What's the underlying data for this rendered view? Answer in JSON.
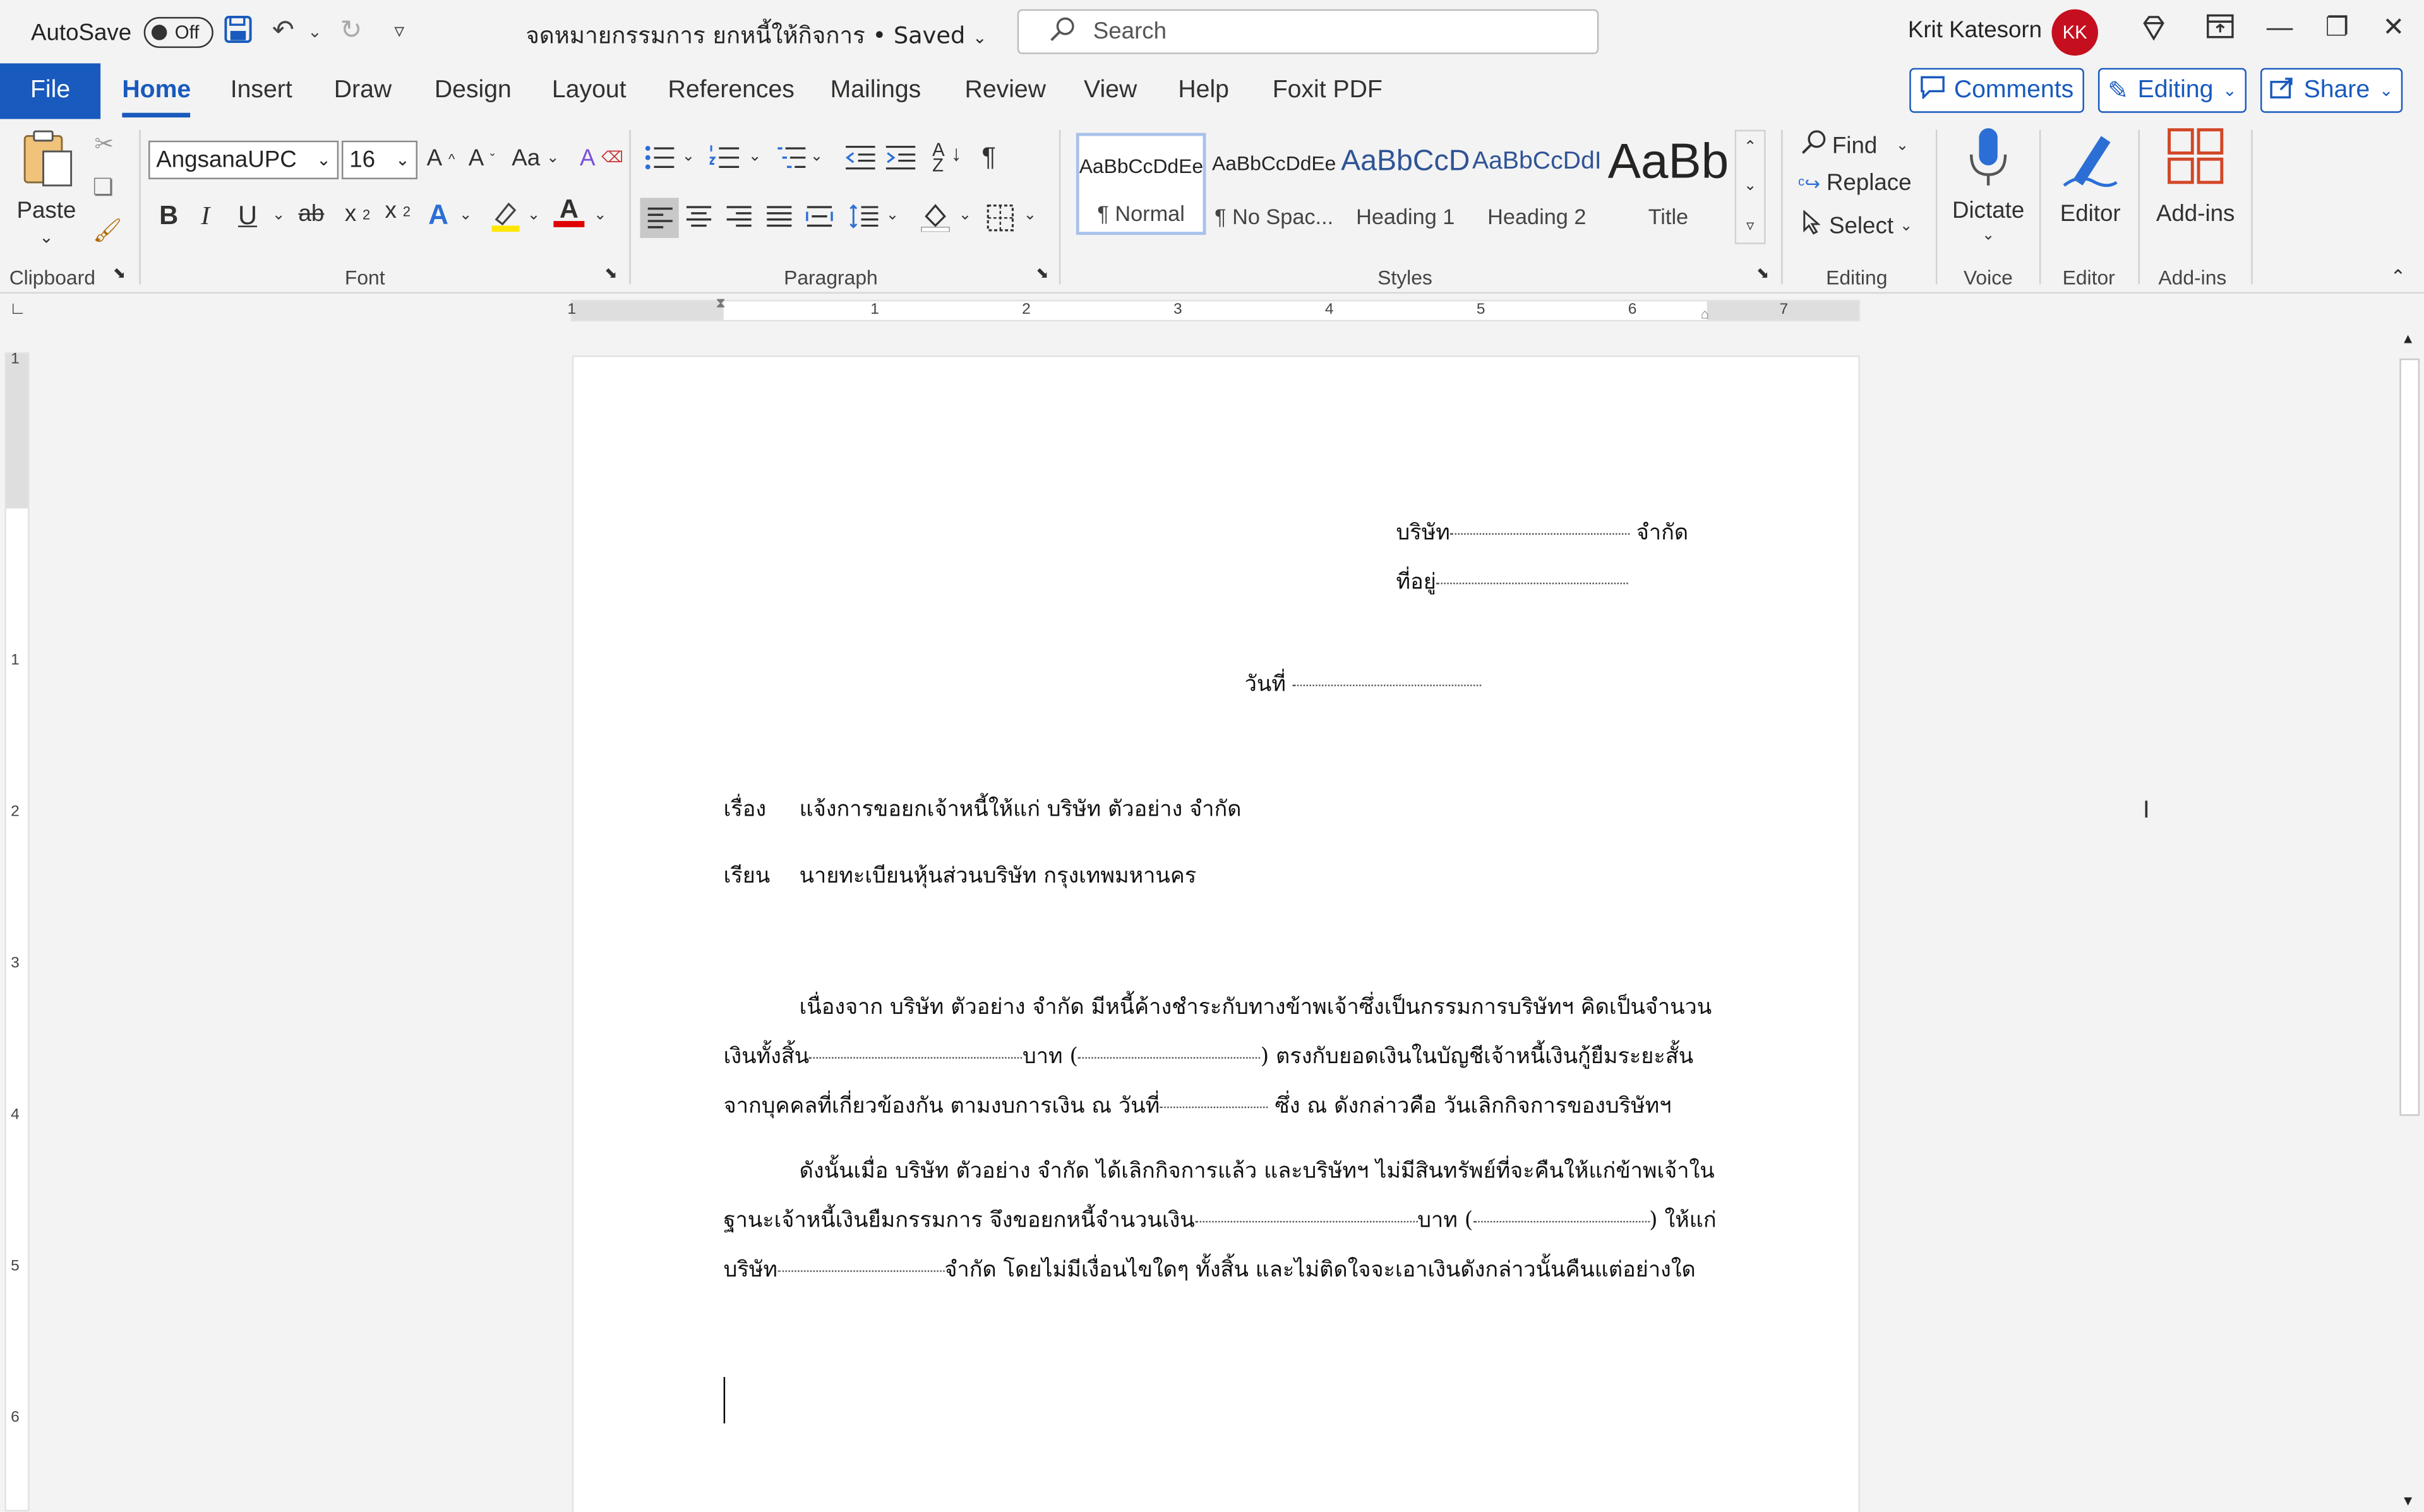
{
  "titlebar": {
    "autosave_label": "AutoSave",
    "autosave_state": "Off",
    "doc_title": "จดหมายกรรมการ ยกหนี้ให้กิจการ • Saved",
    "search_placeholder": "Search",
    "user_name": "Krit Katesorn",
    "user_initials": "KK"
  },
  "tabs": {
    "file": "File",
    "home": "Home",
    "insert": "Insert",
    "draw": "Draw",
    "design": "Design",
    "layout": "Layout",
    "references": "References",
    "mailings": "Mailings",
    "review": "Review",
    "view": "View",
    "help": "Help",
    "foxit": "Foxit PDF",
    "comments": "Comments",
    "editing": "Editing",
    "share": "Share"
  },
  "ribbon": {
    "clipboard": {
      "paste": "Paste",
      "label": "Clipboard"
    },
    "font": {
      "family": "AngsanaUPC",
      "size": "16",
      "label": "Font",
      "case": "Aa"
    },
    "paragraph": {
      "label": "Paragraph"
    },
    "styles": {
      "label": "Styles",
      "items": [
        {
          "sample": "AaBbCcDdEe",
          "name": "¶ Normal"
        },
        {
          "sample": "AaBbCcDdEe",
          "name": "¶ No Spac..."
        },
        {
          "sample": "AaBbCcD",
          "name": "Heading 1"
        },
        {
          "sample": "AaBbCcDdI",
          "name": "Heading 2"
        },
        {
          "sample": "AaBb",
          "name": "Title"
        }
      ]
    },
    "editing": {
      "find": "Find",
      "replace": "Replace",
      "select": "Select",
      "label": "Editing"
    },
    "voice": {
      "dictate": "Dictate",
      "label": "Voice"
    },
    "editor": {
      "editor": "Editor",
      "label": "Editor"
    },
    "addins": {
      "addins": "Add-ins",
      "label": "Add-ins"
    }
  },
  "ruler": {
    "h_numbers": [
      "1",
      "1",
      "2",
      "3",
      "4",
      "5",
      "6",
      "7"
    ],
    "v_numbers": [
      "1",
      "1",
      "2",
      "3",
      "4",
      "5",
      "6"
    ]
  },
  "document": {
    "company_prefix": "บริษัท",
    "company_suffix": "จำกัด",
    "address_label": "ที่อยู่",
    "date_label": "วันที่",
    "subject_label": "เรื่อง",
    "subject_text": "แจ้งการขอยกเจ้าหนี้ให้แก่ บริษัท ตัวอย่าง จำกัด",
    "to_label": "เรียน",
    "to_text": "นายทะเบียนหุ้นส่วนบริษัท กรุงเทพมหานคร",
    "p1_l1": "เนื่องจาก บริษัท ตัวอย่าง จำกัด มีหนี้ค้างชำระกับทางข้าพเจ้าซึ่งเป็นกรรมการบริษัทฯ คิดเป็นจำนวน",
    "p1_l2_a": "เงินทั้งสิ้น",
    "p1_l2_b": "บาท (",
    "p1_l2_c": ") ตรงกับยอดเงินในบัญชีเจ้าหนี้เงินกู้ยืมระยะสั้น",
    "p1_l3_a": "จากบุคคลที่เกี่ยวข้องกัน ตามงบการเงิน ณ วันที่",
    "p1_l3_b": "ซึ่ง ณ ดังกล่าวคือ วันเลิกกิจการของบริษัทฯ",
    "p2_l1": "ดังนั้นเมื่อ บริษัท ตัวอย่าง จำกัด ได้เลิกกิจการแล้ว และบริษัทฯ ไม่มีสินทรัพย์ที่จะคืนให้แก่ข้าพเจ้าใน",
    "p2_l2_a": "ฐานะเจ้าหนี้เงินยืมกรรมการ จึงขอยกหนี้จำนวนเงิน",
    "p2_l2_b": "บาท (",
    "p2_l2_c": ") ให้แก่",
    "p2_l3_a": "บริษัท",
    "p2_l3_b": "จำกัด โดยไม่มีเงื่อนไขใดๆ ทั้งสิ้น และไม่ติดใจจะเอาเงินดังกล่าวนั้นคืนแต่อย่างใด"
  }
}
